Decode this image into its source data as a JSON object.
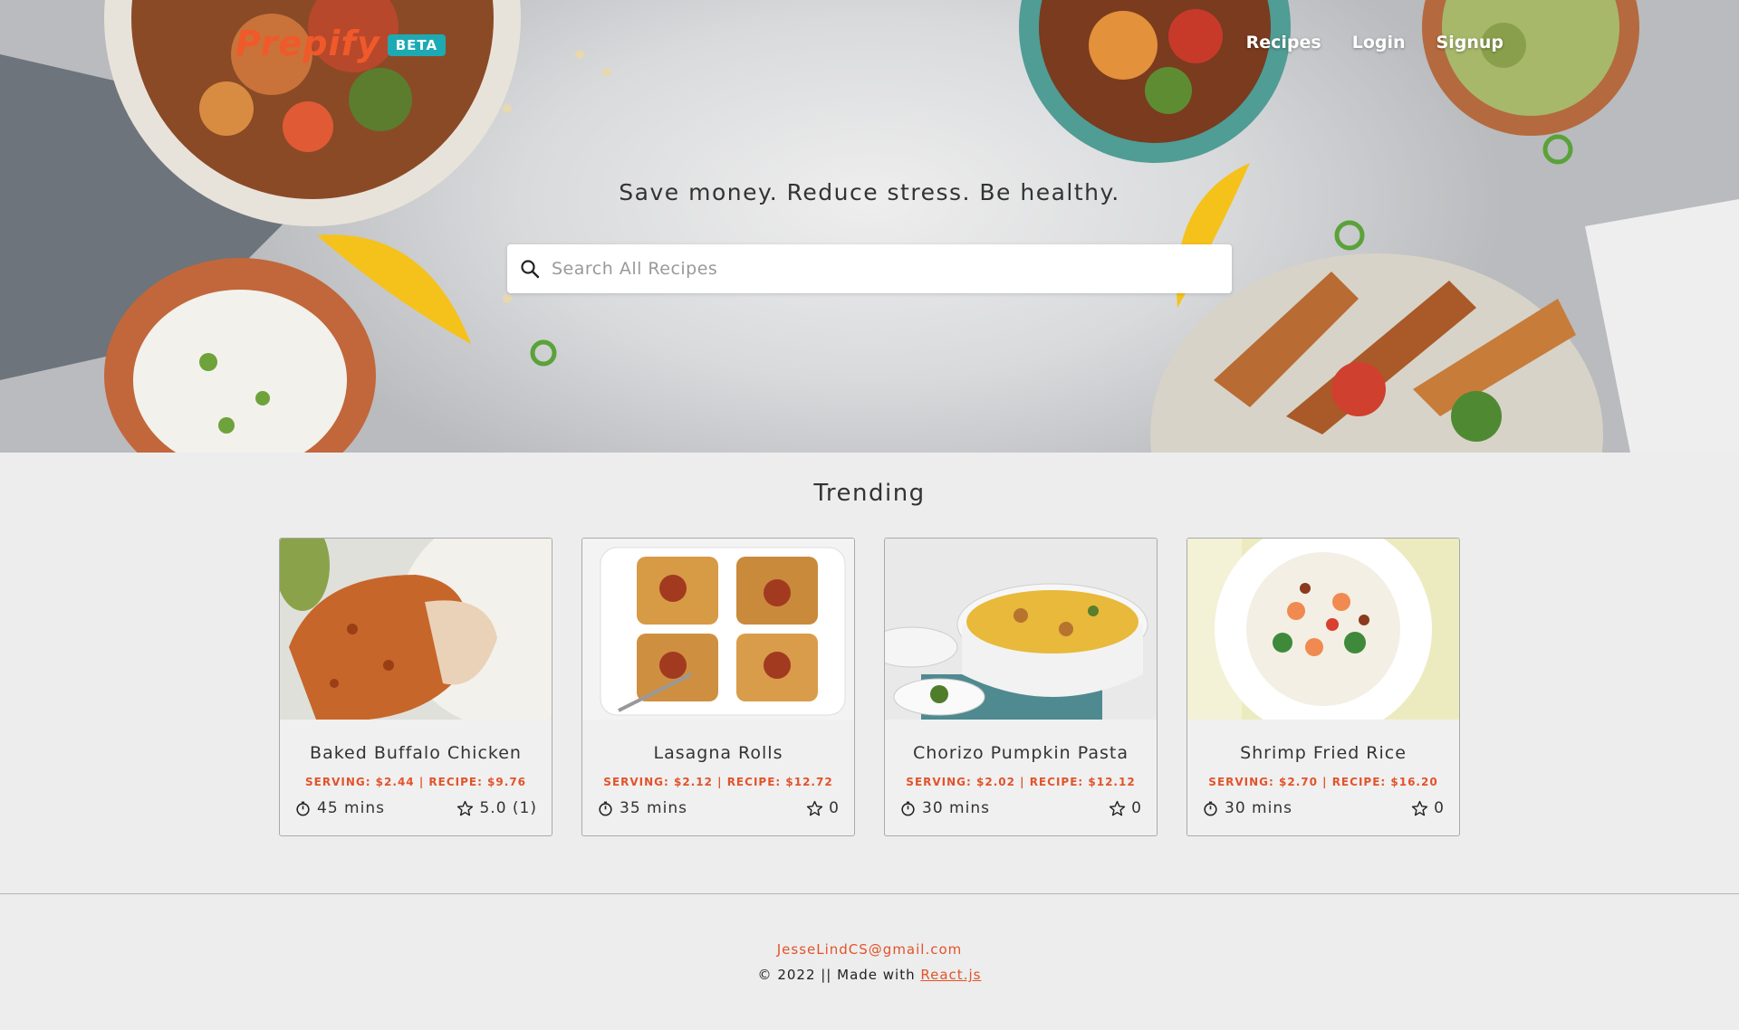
{
  "brand": {
    "logo": "Prepify",
    "badge": "BETA"
  },
  "nav": {
    "links": [
      "Recipes",
      "Login",
      "Signup"
    ]
  },
  "hero": {
    "tagline": "Save money. Reduce stress. Be healthy.",
    "search_placeholder": "Search All Recipes"
  },
  "trending": {
    "title": "Trending",
    "cards": [
      {
        "name": "Baked Buffalo Chicken",
        "price": "SERVING: $2.44 | RECIPE: $9.76",
        "time": "45 mins",
        "rating": "5.0 (1)"
      },
      {
        "name": "Lasagna Rolls",
        "price": "SERVING: $2.12 | RECIPE: $12.72",
        "time": "35 mins",
        "rating": "0"
      },
      {
        "name": "Chorizo Pumpkin Pasta",
        "price": "SERVING: $2.02 | RECIPE: $12.12",
        "time": "30 mins",
        "rating": "0"
      },
      {
        "name": "Shrimp Fried Rice",
        "price": "SERVING: $2.70 | RECIPE: $16.20",
        "time": "30 mins",
        "rating": "0"
      }
    ]
  },
  "footer": {
    "email": "JesseLindCS@gmail.com",
    "copyright_prefix": "© 2022 || Made with",
    "link": "React.js"
  },
  "colors": {
    "accent": "#e2532a",
    "logo": "#f0592a",
    "badge": "#1eaab3",
    "background": "#ededed"
  }
}
